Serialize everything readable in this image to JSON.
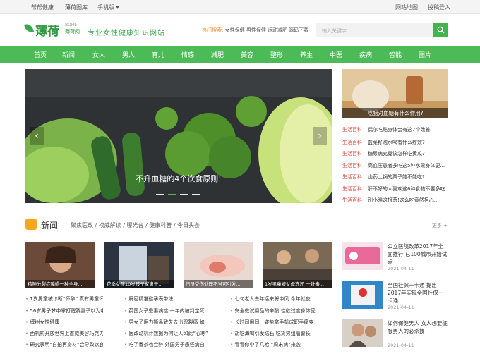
{
  "topbar": {
    "links_left": [
      "帮帮健康",
      "薄荷图库",
      "手机版 ▾"
    ],
    "links_right": [
      "网站地图",
      "投稿登入"
    ]
  },
  "header": {
    "logo": "薄荷",
    "logo_en": "BOHE",
    "logo_sub": "薄荷网",
    "slogan": "专业女性健康知识网站",
    "hot_label": "热门搜索:",
    "hot_keywords": [
      "女性保健",
      "男性保健",
      "运动减肥",
      "源码下载"
    ],
    "search_placeholder": "输入关键字"
  },
  "nav": [
    "首页",
    "新闻",
    "女人",
    "男人",
    "育儿",
    "情感",
    "减肥",
    "美容",
    "整形",
    "养生",
    "中医",
    "疾病",
    "智能",
    "图片"
  ],
  "hero": {
    "caption": "不升血糖的4个饮食原则!",
    "prev": "‹",
    "next": "›"
  },
  "sidebar": {
    "feature_caption": "吃醋对血糖有什么作用?",
    "items": [
      {
        "tag": "生活百科",
        "title": "偶尔吃點身体会有这7个改善"
      },
      {
        "tag": "生活百科",
        "title": "盒菜籽泡水喝有什么疗效?"
      },
      {
        "tag": "生活百科",
        "title": "糖尿病究竟该怎样吃黄瓜?"
      },
      {
        "tag": "生活百科",
        "title": "高血压患者多吃这5种水果身体更..."
      },
      {
        "tag": "生活百科",
        "title": "山药上锅的栗子能不能吃?"
      },
      {
        "tag": "生活百科",
        "title": "肝不好的人喜欢这6种食物不要多吃"
      },
      {
        "tag": "生活百科",
        "title": "别小瞧这根葱!这么吃竟然担心..."
      }
    ]
  },
  "news": {
    "title": "新闻",
    "tabs": "聚焦医改 / 权威解读 / 曝光台 / 健康科普 / 今日头条",
    "more": "更多 +",
    "thumbs": [
      {
        "caption": "精神分裂症障碍一种全身..."
      },
      {
        "caption": "花季女孩10岁孩子家患子..."
      },
      {
        "caption": "伤员受伤处理不当可引发..."
      },
      {
        "caption": "1岁男童被父母冻坏 一针毒..."
      }
    ],
    "list_col1": [
      "1岁男童被诊断“怀孕” 真有男童怀孕事",
      "56岁男子梦中掌打醒腾妻子以为中邪",
      "缠树女性健康",
      "西机构开放世界上首款美容巧克力",
      "研究表明“自拍再身材”会导致饮食"
    ],
    "list_col2": [
      "解密精准避孕表带法",
      "英国女子患妻病症 一年内被判定死",
      "男女子用力撕鼻致失去出现裂痛 如",
      "医改动机计数据为何让人如此“心寒”",
      "吃了番茶也会醉 外国男子患怪病自"
    ],
    "list_col3": [
      "七旬老人去年接来将中风 今年就夜",
      "安全教试用品的辛酸:性欲过度身体受",
      "长时间用同一姿势拿手机成职手痛变",
      "胡吃海喝引发结石 吃货男组瘤警长",
      "看看你中了几枪 “周末病”来袭"
    ],
    "right_cards": [
      {
        "title": "公立医院改革2017年全面推行 已100城市开始试点",
        "date": "2021-04-11"
      },
      {
        "title": "全国社保一卡通 提出2017年实现全国社保一卡通",
        "date": "2021-04-11"
      },
      {
        "title": "如何保健男人 女人想要征服男人的必杀技",
        "date": "2021-04-11"
      }
    ]
  },
  "colors": {
    "brand": "#4cbb57",
    "tag": "#e2483b",
    "accent": "#f5a623"
  }
}
